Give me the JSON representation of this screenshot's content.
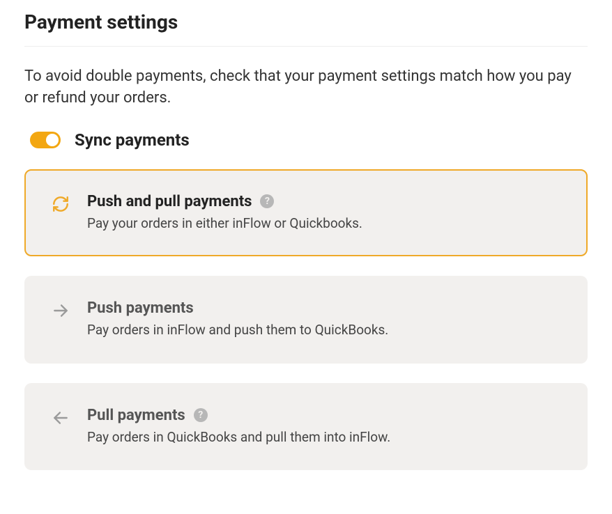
{
  "title": "Payment settings",
  "intro": "To avoid double payments, check that your payment settings match how you pay or refund your orders.",
  "syncToggle": {
    "label": "Sync payments",
    "on": true
  },
  "options": [
    {
      "title": "Push and pull payments",
      "desc": "Pay your orders in either inFlow or Quickbooks.",
      "hasHelp": true,
      "selected": true
    },
    {
      "title": "Push payments",
      "desc": "Pay orders in inFlow and push them to QuickBooks.",
      "hasHelp": false,
      "selected": false
    },
    {
      "title": "Pull payments",
      "desc": "Pay orders in QuickBooks and pull them into inFlow.",
      "hasHelp": true,
      "selected": false
    }
  ]
}
